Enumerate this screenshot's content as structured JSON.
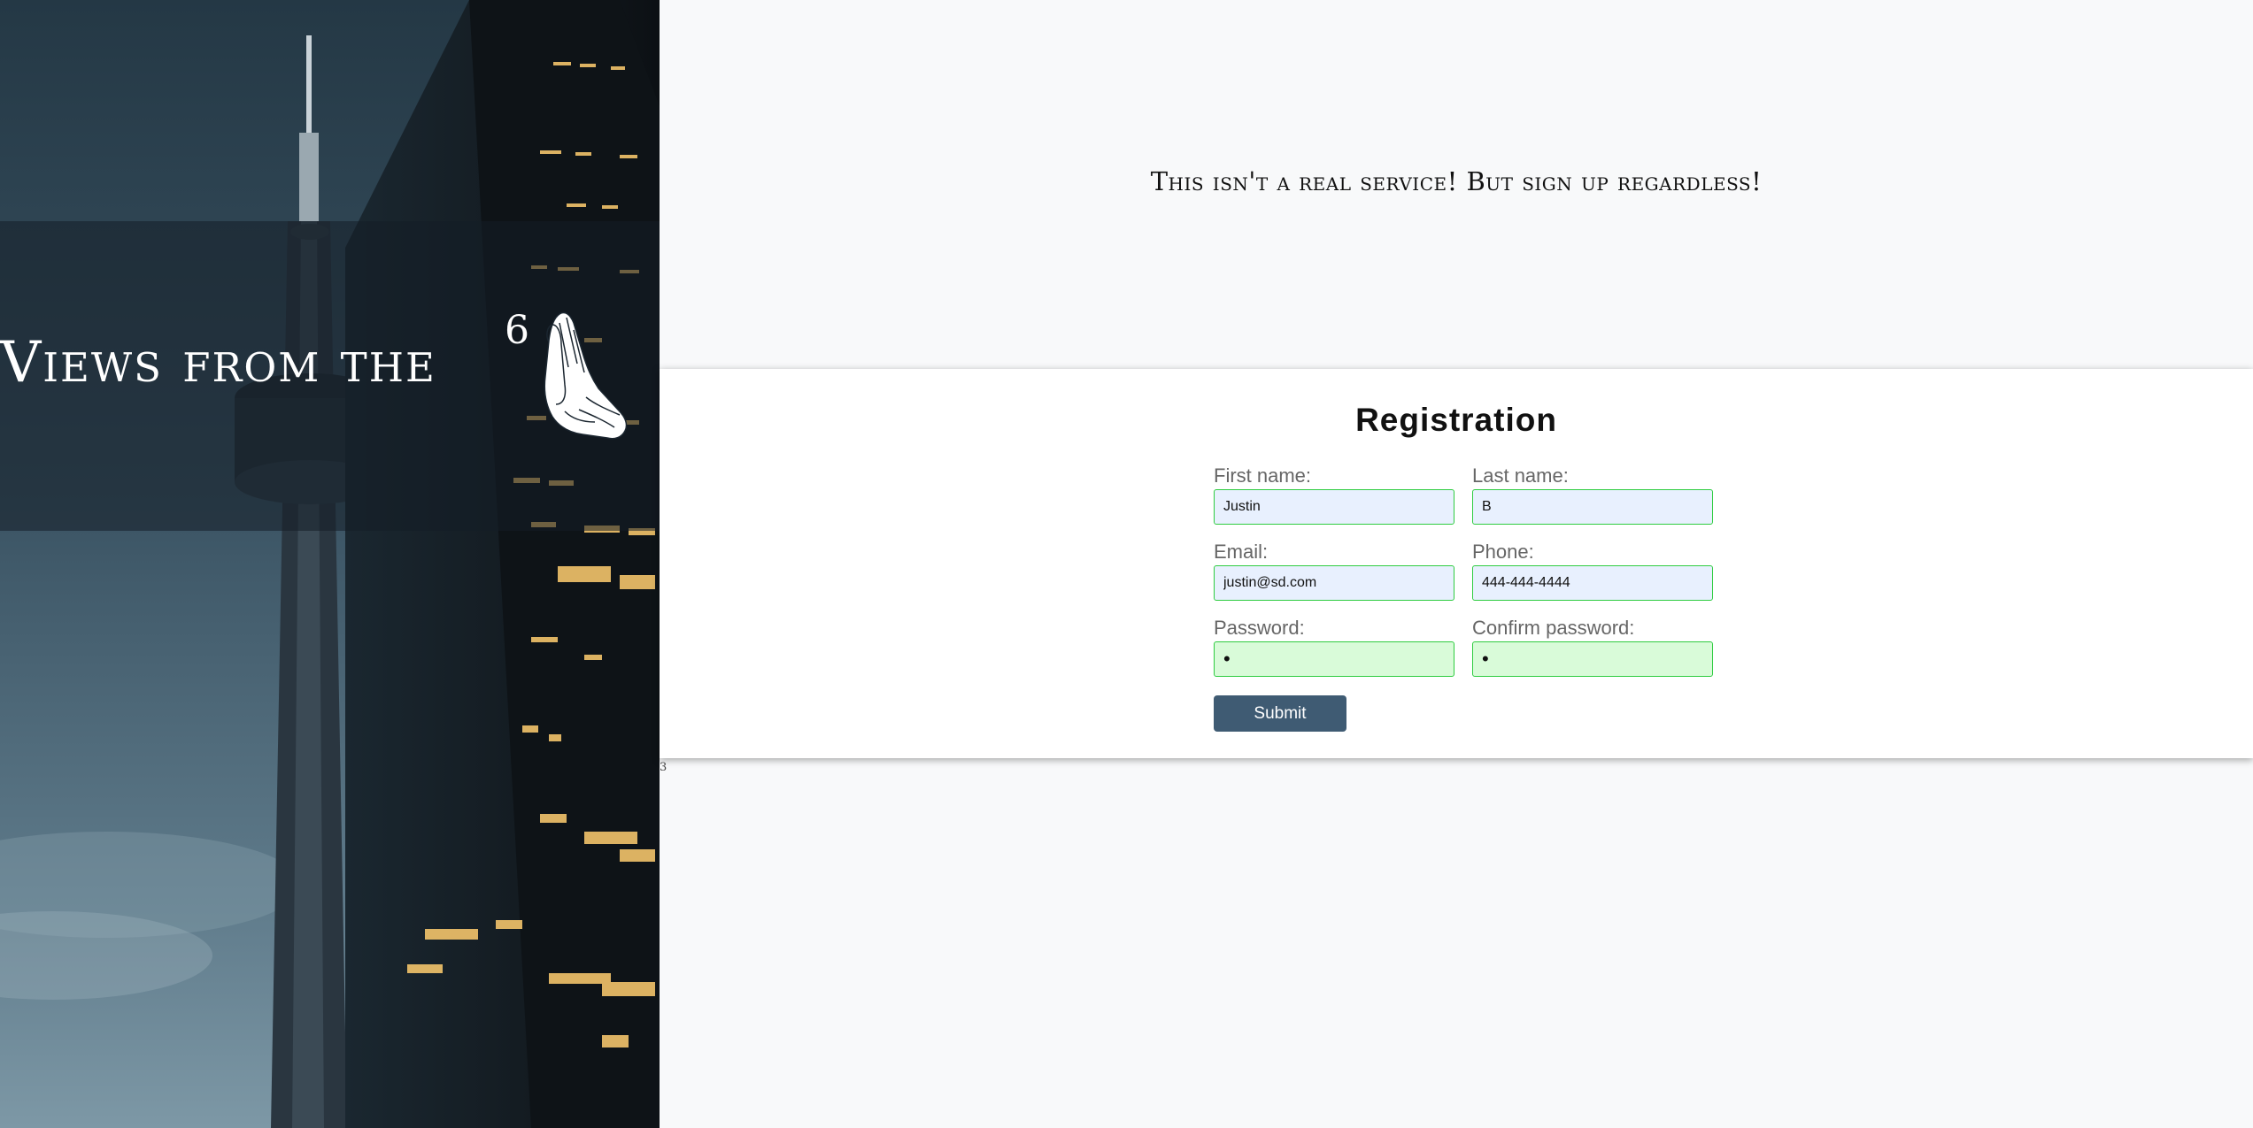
{
  "hero": {
    "title": "Views from the",
    "superscript": "6",
    "image_icon": "praying-hands-icon"
  },
  "tagline": "This isn't a real service! But sign up regardless!",
  "form": {
    "title": "Registration",
    "first_name": {
      "label": "First name:",
      "value": "Justin"
    },
    "last_name": {
      "label": "Last name:",
      "value": "B"
    },
    "email": {
      "label": "Email:",
      "value": "justin@sd.com"
    },
    "phone": {
      "label": "Phone:",
      "value": "444-444-4444"
    },
    "password": {
      "label": "Password:",
      "value": "•"
    },
    "confirm_password": {
      "label": "Confirm password:",
      "value": "•"
    },
    "submit_label": "Submit"
  },
  "footnote": "3",
  "colors": {
    "submit_bg": "#3f5b73",
    "valid_border": "#2ecc40",
    "autofill_bg": "#e8f0fe",
    "password_bg": "#d9fbd9"
  }
}
